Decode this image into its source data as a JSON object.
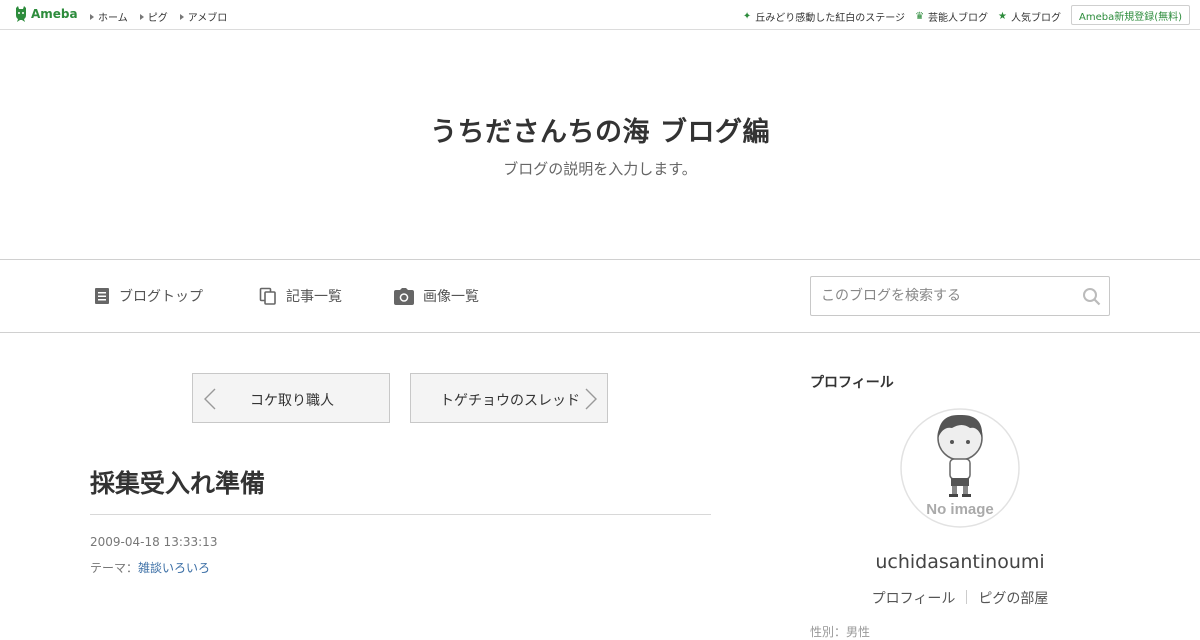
{
  "global_header": {
    "logo": "Ameba",
    "left_links": [
      "ホーム",
      "ピグ",
      "アメブロ"
    ],
    "right_links": [
      {
        "label": "丘みどり感動した紅白のステージ",
        "icon": "sparkle-icon"
      },
      {
        "label": "芸能人ブログ",
        "icon": "crown-icon"
      },
      {
        "label": "人気ブログ",
        "icon": "star-icon"
      }
    ],
    "register": "Ameba新規登録(無料)"
  },
  "blog": {
    "title": "うちださんちの海 ブログ編",
    "description": "ブログの説明を入力します。"
  },
  "nav": {
    "items": [
      {
        "label": "ブログトップ",
        "icon": "document-icon"
      },
      {
        "label": "記事一覧",
        "icon": "copy-icon"
      },
      {
        "label": "画像一覧",
        "icon": "camera-icon"
      }
    ],
    "search_placeholder": "このブログを検索する"
  },
  "pager": {
    "prev": "コケ取り職人",
    "next": "トゲチョウのスレッド"
  },
  "article": {
    "title": "採集受入れ準備",
    "date": "2009-04-18 13:33:13",
    "theme_label": "テーマ：",
    "theme": "雑談いろいろ"
  },
  "sidebar": {
    "heading": "プロフィール",
    "avatar_text": "No image",
    "username": "uchidasantinoumi",
    "links": [
      "プロフィール",
      "ピグの部屋"
    ],
    "more": "性別：男性"
  },
  "colors": {
    "brand_green": "#2d8c3c",
    "link_blue": "#3a6ea5"
  }
}
